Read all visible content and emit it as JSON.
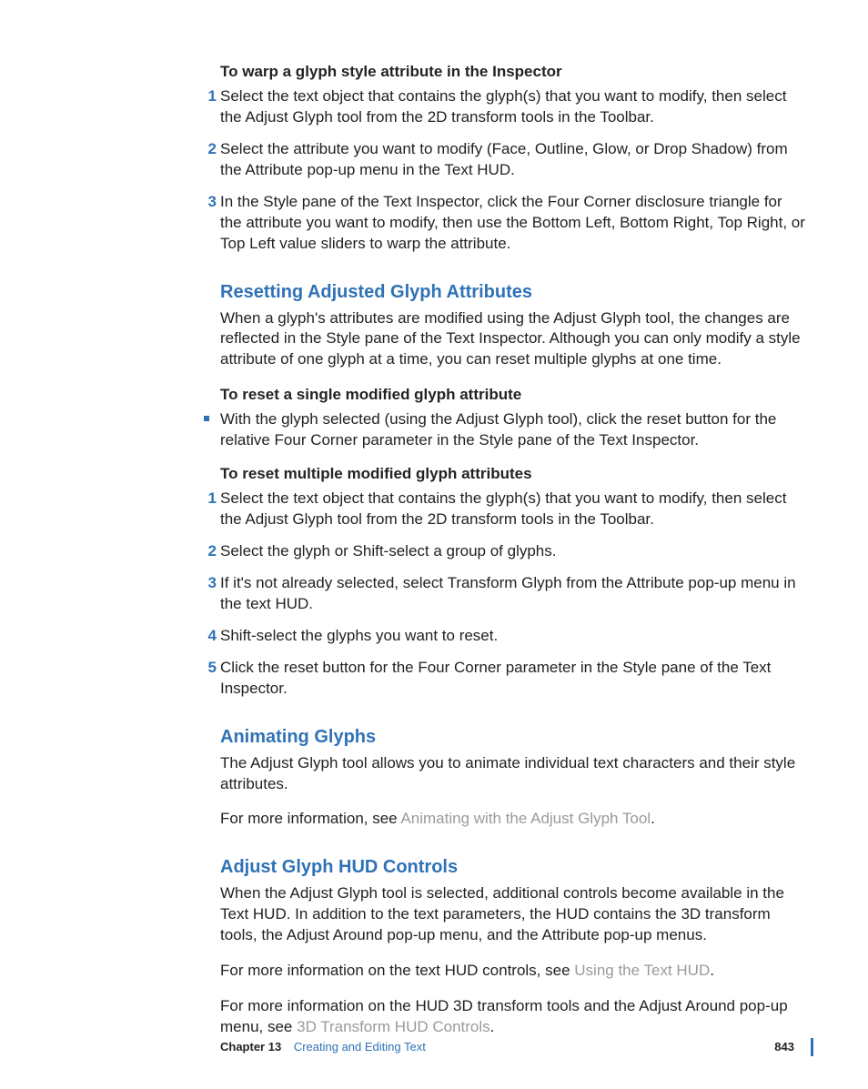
{
  "section1": {
    "lead": "To warp a glyph style attribute in the Inspector",
    "steps": [
      "Select the text object that contains the glyph(s) that you want to modify, then select the Adjust Glyph tool from the 2D transform tools in the Toolbar.",
      "Select the attribute you want to modify (Face, Outline, Glow, or Drop Shadow) from the Attribute pop-up menu in the Text HUD.",
      "In the Style pane of the Text Inspector, click the Four Corner disclosure triangle for the attribute you want to modify, then use the Bottom Left, Bottom Right, Top Right, or Top Left value sliders to warp the attribute."
    ]
  },
  "section2": {
    "heading": "Resetting Adjusted Glyph Attributes",
    "intro": "When a glyph's attributes are modified using the Adjust Glyph tool, the changes are reflected in the Style pane of the Text Inspector. Although you can only modify a style attribute of one glyph at a time, you can reset multiple glyphs at one time.",
    "lead1": "To reset a single modified glyph attribute",
    "bullet": "With the glyph selected (using the Adjust Glyph tool), click the reset button for the relative Four Corner parameter in the Style pane of the Text Inspector.",
    "lead2": "To reset multiple modified glyph attributes",
    "steps": [
      "Select the text object that contains the glyph(s) that you want to modify, then select the Adjust Glyph tool from the 2D transform tools in the Toolbar.",
      "Select the glyph or Shift-select a group of glyphs.",
      "If it's not already selected, select Transform Glyph from the Attribute pop-up menu in the text HUD.",
      "Shift-select the glyphs you want to reset.",
      "Click the reset button for the Four Corner parameter in the Style pane of the Text Inspector."
    ]
  },
  "section3": {
    "heading": "Animating Glyphs",
    "intro": "The Adjust Glyph tool allows you to animate individual text characters and their style attributes.",
    "more_pre": "For more information, see ",
    "more_link": "Animating with the Adjust Glyph Tool",
    "more_post": "."
  },
  "section4": {
    "heading": "Adjust Glyph HUD Controls",
    "intro": "When the Adjust Glyph tool is selected, additional controls become available in the Text HUD. In addition to the text parameters, the HUD contains the 3D transform tools, the Adjust Around pop-up menu, and the Attribute pop-up menus.",
    "p2_pre": "For more information on the text HUD controls, see ",
    "p2_link": "Using the Text HUD",
    "p2_post": ".",
    "p3_pre": "For more information on the HUD 3D transform tools and the Adjust Around pop-up menu, see ",
    "p3_link": "3D Transform HUD Controls",
    "p3_post": "."
  },
  "footer": {
    "chapter_label": "Chapter 13",
    "chapter_title": "Creating and Editing Text",
    "page": "843"
  }
}
